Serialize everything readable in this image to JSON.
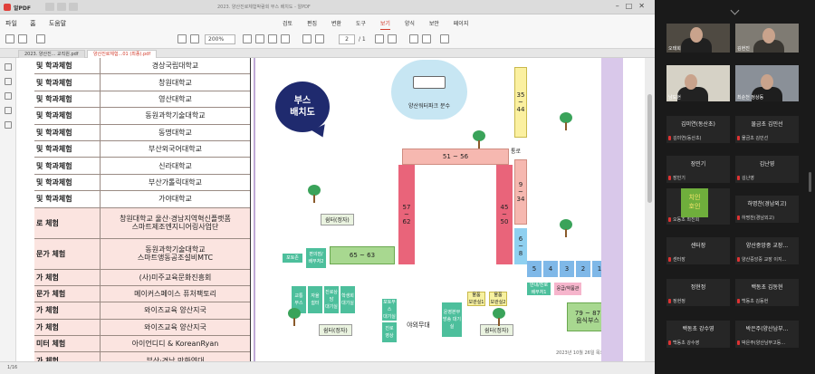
{
  "viewer": {
    "app_name": "알PDF",
    "window_title": "2023. 양산진로체험박람회 부스 배치도 - 알PDF",
    "menu": [
      "파일",
      "홈",
      "도움말"
    ],
    "tabs": [
      "검토",
      "편집",
      "변환",
      "도구",
      "보기",
      "양식",
      "보안",
      "페이지"
    ],
    "active_tab": "보기",
    "zoom": "200%",
    "page_current": "2",
    "page_total": "/ 1",
    "doc_tabs": [
      "2023. 양산진... 교직원.pdf",
      "양산진로체험...01 (최종).pdf"
    ],
    "status": "1/16"
  },
  "table": {
    "rows": [
      {
        "category": "및 학과체험",
        "name": "경상국립대학교",
        "pink": false
      },
      {
        "category": "및 학과체험",
        "name": "창원대학교",
        "pink": false
      },
      {
        "category": "및 학과체험",
        "name": "영산대학교",
        "pink": false
      },
      {
        "category": "및 학과체험",
        "name": "동원과학기술대학교",
        "pink": false
      },
      {
        "category": "및 학과체험",
        "name": "동명대학교",
        "pink": false
      },
      {
        "category": "및 학과체험",
        "name": "부산외국어대학교",
        "pink": false
      },
      {
        "category": "및 학과체험",
        "name": "신라대학교",
        "pink": false
      },
      {
        "category": "및 학과체험",
        "name": "부산가톨릭대학교",
        "pink": false
      },
      {
        "category": "및 학과체험",
        "name": "가야대학교",
        "pink": false
      },
      {
        "category": "로 체험",
        "name": "창원대학교 울산·경남지역혁신플랫폼\n스마트제조엔지니어링사업단",
        "pink": true,
        "tall": true
      },
      {
        "category": "문가 체험",
        "name": "동원과학기술대학교\n스마트앵동공조설비MTC",
        "pink": true,
        "tall": true
      },
      {
        "category": "가 체험",
        "name": "(사)미주교육문화진흥회",
        "pink": true
      },
      {
        "category": "문가 체험",
        "name": "메이커스페이스 퓨처팩토리",
        "pink": true
      },
      {
        "category": "가 체험",
        "name": "와이즈교육 양산지국",
        "pink": true
      },
      {
        "category": "가 체험",
        "name": "와이즈교육 양산지국",
        "pink": true
      },
      {
        "category": "미터 체험",
        "name": "아이언디디 & KoreanRyan",
        "pink": true
      },
      {
        "category": "가 체험",
        "name": "부산·경남 만화연대",
        "pink": true
      }
    ]
  },
  "map": {
    "bubble": "부스\n배치도",
    "fountain": "양산워터파크 분수",
    "z_35_44": "35\n~\n44",
    "z_51_56": "51 ~ 56",
    "road": "통로",
    "z_9_34": "9\n~\n34",
    "z_57_62": "57\n~\n62",
    "z_45_50": "45\n~\n50",
    "z_6_8": "6\n~\n8",
    "z_65_63": "65 ~ 63",
    "z_forecourt": "포토존",
    "z_green2": "편의점/\n배부처2",
    "shade_top": "쉼터(정자)",
    "z_5": "5",
    "z_4": "4",
    "z_3": "3",
    "z_2": "2",
    "z_1": "1",
    "z_reception1": "안내/진로\n배부처1",
    "z_emergency": "응급/약품관",
    "z_79_87": "79 ~ 87\n음식부스",
    "z_tl1": "교통\n부스",
    "z_tl2": "자율\n쉼터",
    "z_tl3": "진로상담\n대기실",
    "z_tl4": "학생회\n대기실",
    "z_stage_left": "포토부스\n대기실",
    "z_stage_small": "진로\n영상",
    "stage": "야외무대",
    "z_stage_right": "운영본부\n방송 대기실",
    "z_storage1": "물품\n보관실1",
    "z_storage2": "물품\n보관실2",
    "shade_bottom_left": "쉼터(정자)",
    "shade_bottom_right": "쉼터(정자)",
    "date": "2023년 10월 26일 목요일"
  },
  "participants": [
    {
      "name": "",
      "sub": "오태희",
      "camera": true
    },
    {
      "name": "",
      "sub": "김현진",
      "camera": true
    },
    {
      "name": "",
      "sub": "남도현",
      "camera": true
    },
    {
      "name": "",
      "sub": "최순천 정상동",
      "camera": true
    },
    {
      "name": "김미연(동산초)",
      "sub": "김미연(동산초)"
    },
    {
      "name": "물금초 김민선",
      "sub": "물금초 김민선"
    },
    {
      "name": "장민기",
      "sub": "장민기"
    },
    {
      "name": "김난영",
      "sub": "김난영"
    },
    {
      "name": "",
      "sub": "오동초 최진희",
      "avatar": "치인\n호인"
    },
    {
      "name": "하명찬(경남외고)",
      "sub": "하명찬(경남외고)"
    },
    {
      "name": "센터장",
      "sub": "센터장"
    },
    {
      "name": "양산중앙중 교장...",
      "sub": "양산중앙중 교장 이지..."
    },
    {
      "name": "정현정",
      "sub": "정현정"
    },
    {
      "name": "백동초 김동현",
      "sub": "백동초 김동현"
    },
    {
      "name": "백동초 강수영",
      "sub": "백동초 강수영"
    },
    {
      "name": "박은주(양산남부...",
      "sub": "박은주(양산남부고등..."
    }
  ]
}
